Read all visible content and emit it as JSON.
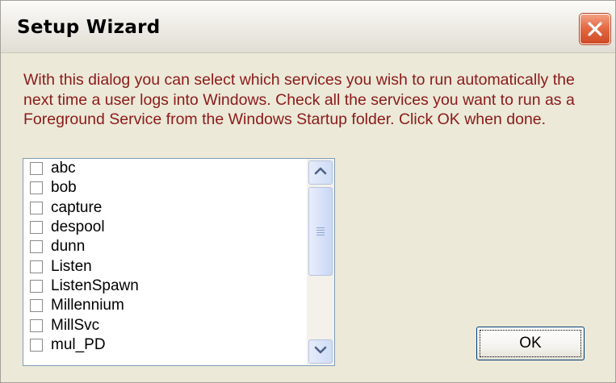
{
  "window": {
    "title": "Setup Wizard"
  },
  "dialog": {
    "instructions": "With this dialog you can select which services you wish to run automatically the next time a user logs into Windows. Check all the services you want to run as a Foreground Service from the Windows Startup folder. Click OK when done."
  },
  "services": {
    "items": [
      {
        "label": "abc",
        "checked": false
      },
      {
        "label": "bob",
        "checked": false
      },
      {
        "label": "capture",
        "checked": false
      },
      {
        "label": "despool",
        "checked": false
      },
      {
        "label": "dunn",
        "checked": false
      },
      {
        "label": "Listen",
        "checked": false
      },
      {
        "label": "ListenSpawn",
        "checked": false
      },
      {
        "label": "Millennium",
        "checked": false
      },
      {
        "label": "MillSvc",
        "checked": false
      },
      {
        "label": "mul_PD",
        "checked": false
      }
    ]
  },
  "buttons": {
    "ok_label": "OK"
  },
  "icons": {
    "close": "close-icon",
    "scroll_up": "chevron-up-icon",
    "scroll_down": "chevron-down-icon"
  },
  "colors": {
    "instruction_text": "#8b1a1a",
    "close_button": "#e46b45",
    "dialog_background": "#ece9d8"
  }
}
